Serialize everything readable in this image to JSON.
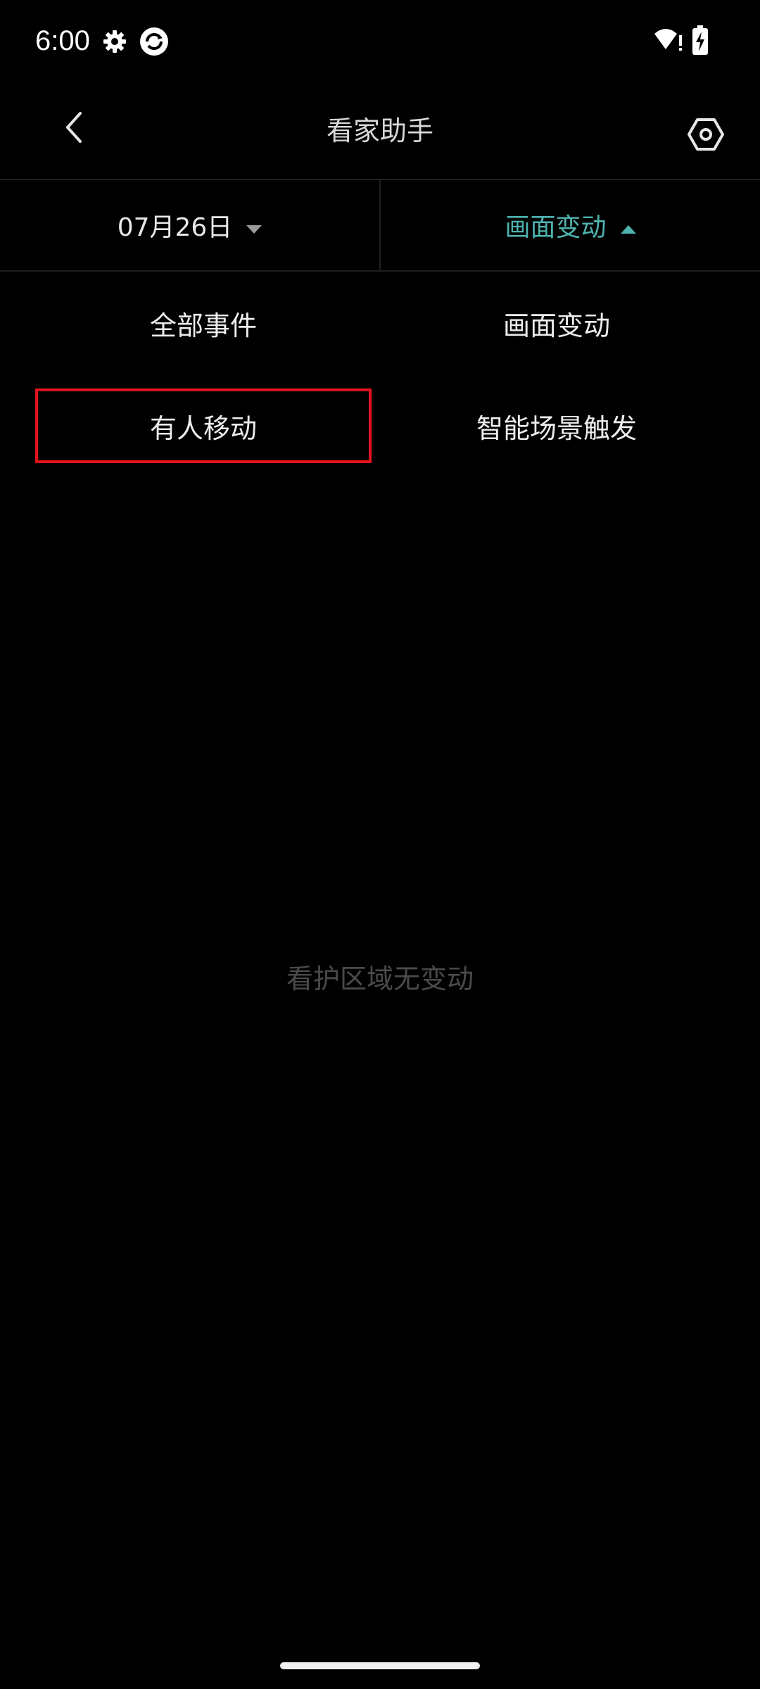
{
  "status_bar": {
    "time": "6:00",
    "icons": [
      "gear-icon",
      "sync-app-icon",
      "wifi-alert-icon",
      "battery-charging-icon"
    ]
  },
  "header": {
    "title": "看家助手",
    "back_icon": "chevron-left-icon",
    "settings_icon": "hexagon-settings-icon"
  },
  "filters": {
    "date": "07月26日",
    "date_caret": "caret-down-icon",
    "type": "画面变动",
    "type_caret": "caret-up-icon",
    "accent_color": "#4fb3b0"
  },
  "options": [
    {
      "label": "全部事件",
      "selected": false
    },
    {
      "label": "画面变动",
      "selected": false
    },
    {
      "label": "有人移动",
      "selected": true
    },
    {
      "label": "智能场景触发",
      "selected": false
    }
  ],
  "empty_state": {
    "message": "看护区域无变动"
  },
  "colors": {
    "background": "#000000",
    "selection_border": "#e0141a"
  }
}
